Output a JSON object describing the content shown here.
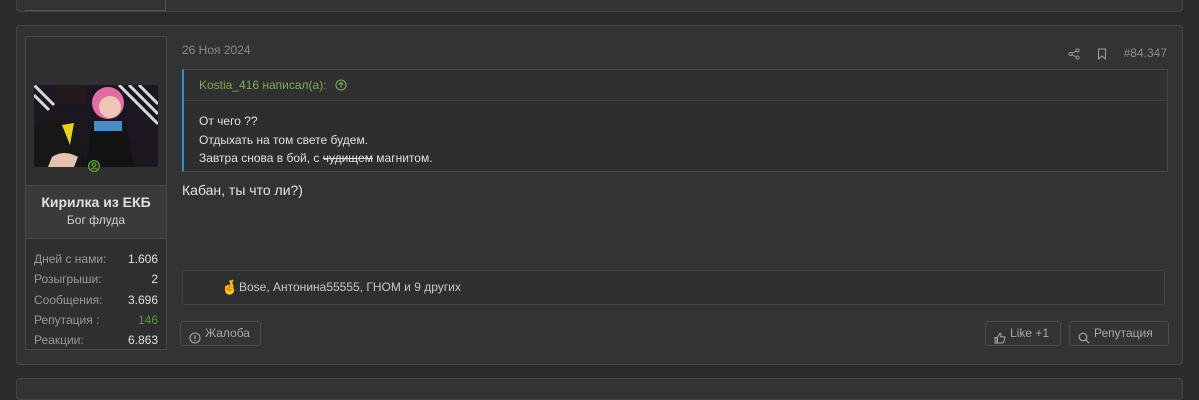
{
  "post": {
    "date": "26 Ноя 2024",
    "number": "#84.347",
    "author": {
      "name": "Кирилка из ЕКБ",
      "title": "Бог флуда",
      "stats": [
        {
          "label": "Дней с нами:",
          "value": "1.606"
        },
        {
          "label": "Розыгрыши:",
          "value": "2"
        },
        {
          "label": "Сообщения:",
          "value": "3.696"
        },
        {
          "label": "Репутация :",
          "value": "146"
        },
        {
          "label": "Реакции:",
          "value": "6.863"
        }
      ]
    },
    "quote": {
      "author_line": "Kostia_416 написал(а):",
      "lines": [
        "От чего ??",
        "Отдыхать на том свете будем."
      ],
      "line3_prefix": "Завтра снова в бой, с ",
      "line3_struck": "чудищем",
      "line3_suffix": " магнитом."
    },
    "message": "Кабан, ты что ли?)",
    "reactions": {
      "emoji": "🤞",
      "text": "Bose, Антонина55555, ГНОМ и 9 других"
    },
    "buttons": {
      "report": "Жалоба",
      "like": "Like +1",
      "reputation": "Репутация"
    }
  },
  "colors": {
    "accent_blue": "#2f8dd6",
    "quote_author": "#7fa85a",
    "reputation_green": "#4e9a3a",
    "background": "#2b2b2b",
    "card": "#333333"
  },
  "icons": {
    "share": "share-icon",
    "bookmark": "bookmark-icon",
    "quote_jump": "arrow-up-circle-icon",
    "report": "warning-circle-icon",
    "like": "thumbs-up-icon",
    "reputation": "search-icon",
    "online": "online-status-icon"
  }
}
